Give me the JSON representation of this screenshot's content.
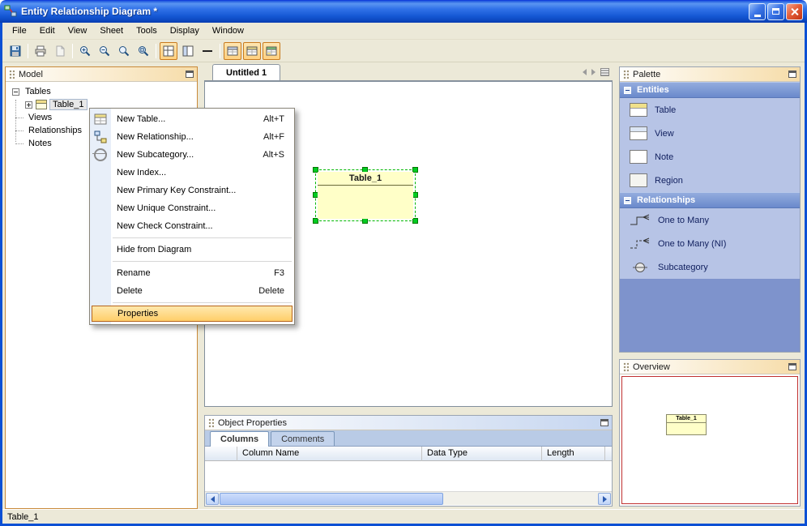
{
  "window": {
    "title": "Entity Relationship Diagram *"
  },
  "menu": {
    "items": [
      "File",
      "Edit",
      "View",
      "Sheet",
      "Tools",
      "Display",
      "Window"
    ]
  },
  "toolbar": {
    "icons": [
      "save",
      "print",
      "page-setup",
      "zoom-in",
      "zoom-out",
      "zoom-actual",
      "zoom-fit",
      "toggle-grid",
      "toggle-panes",
      "toggle-line",
      "table-view-1",
      "table-view-2",
      "table-view-3"
    ]
  },
  "model_panel": {
    "title": "Model",
    "tree": {
      "root": "Tables",
      "child": "Table_1",
      "siblings": [
        "Views",
        "Relationships",
        "Notes"
      ]
    }
  },
  "context_menu": {
    "items": [
      {
        "label": "New Table...",
        "shortcut": "Alt+T"
      },
      {
        "label": "New Relationship...",
        "shortcut": "Alt+F"
      },
      {
        "label": "New Subcategory...",
        "shortcut": "Alt+S"
      },
      {
        "label": "New Index...",
        "shortcut": ""
      },
      {
        "label": "New Primary Key Constraint...",
        "shortcut": ""
      },
      {
        "label": "New Unique Constraint...",
        "shortcut": ""
      },
      {
        "label": "New Check Constraint...",
        "shortcut": ""
      },
      {
        "label": "Hide from Diagram",
        "shortcut": ""
      },
      {
        "label": "Rename",
        "shortcut": "F3"
      },
      {
        "label": "Delete",
        "shortcut": "Delete"
      },
      {
        "label": "Properties",
        "shortcut": ""
      }
    ]
  },
  "canvas": {
    "tab": "Untitled 1",
    "entity_title": "Table_1"
  },
  "palette": {
    "title": "Palette",
    "sections": [
      {
        "title": "Entities",
        "items": [
          {
            "label": "Table"
          },
          {
            "label": "View"
          },
          {
            "label": "Note"
          },
          {
            "label": "Region"
          }
        ]
      },
      {
        "title": "Relationships",
        "items": [
          {
            "label": "One to Many"
          },
          {
            "label": "One to Many (NI)"
          },
          {
            "label": "Subcategory"
          }
        ]
      }
    ]
  },
  "overview": {
    "title": "Overview",
    "thumbnail_label": "Table_1"
  },
  "object_properties": {
    "title": "Object Properties",
    "tabs": [
      "Columns",
      "Comments"
    ],
    "columns": [
      "Column Name",
      "Data Type",
      "Length"
    ]
  },
  "status_bar": {
    "text": "Table_1"
  },
  "colors": {
    "titlebar_blue": "#1659D5",
    "selection_orange": "#FFCE69",
    "handle_green": "#00CC22",
    "entity_fill": "#FFFFC8",
    "palette_blue": "#7E93CC",
    "overview_viewport_red": "#C03030"
  }
}
